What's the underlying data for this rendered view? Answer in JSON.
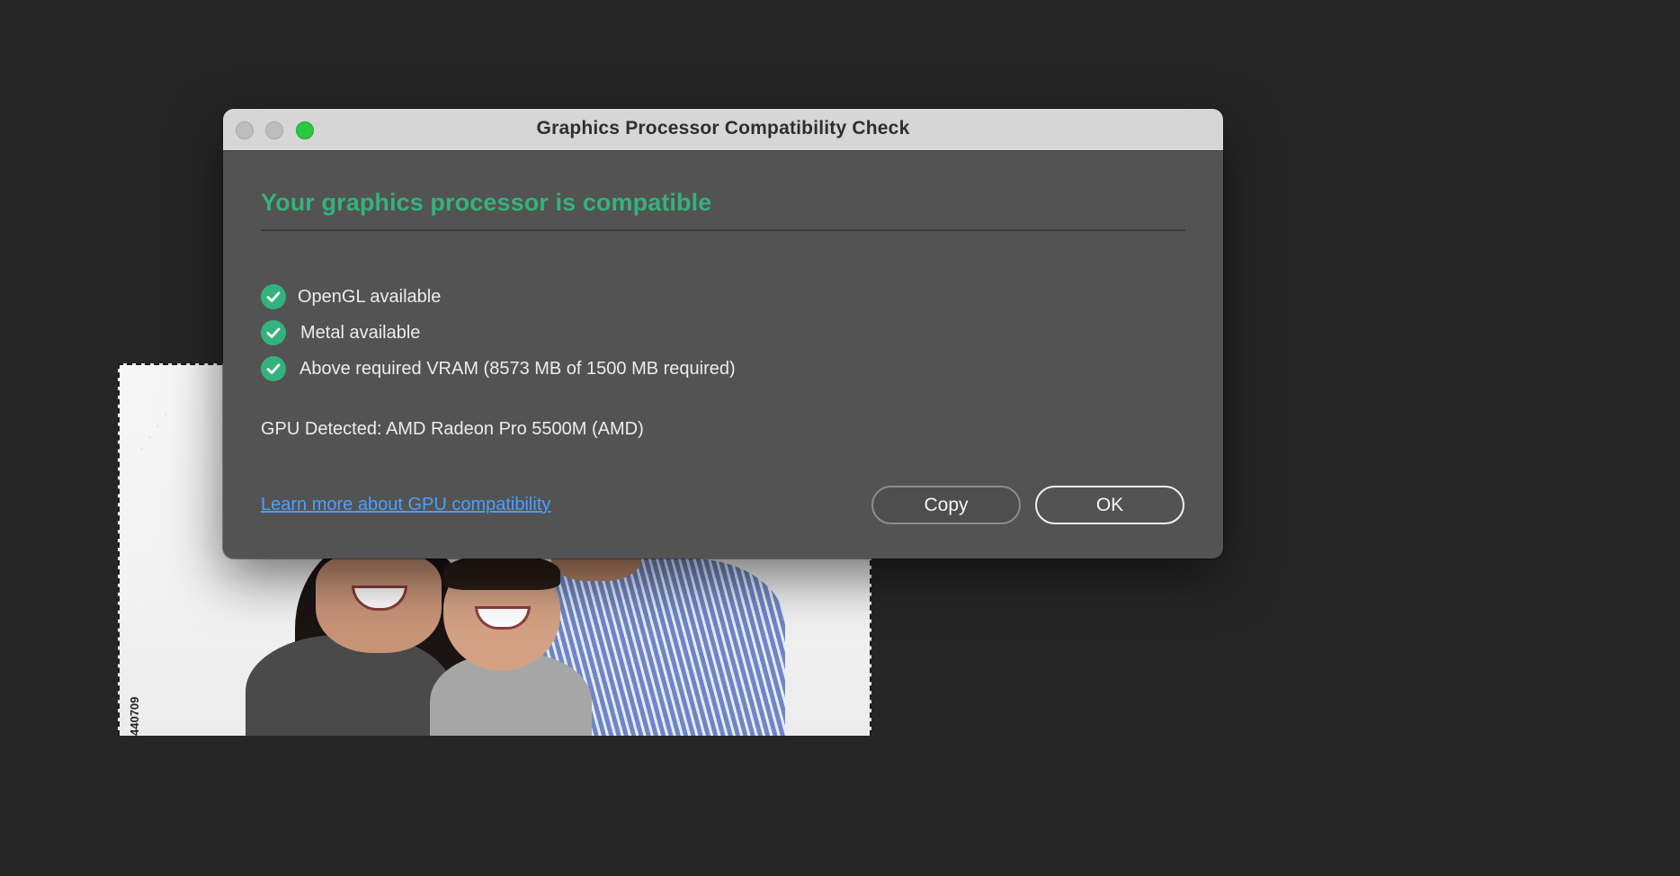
{
  "dialog": {
    "title": "Graphics Processor Compatibility Check",
    "headline": "Your graphics processor is compatible",
    "checks": [
      {
        "label": "OpenGL available"
      },
      {
        "label": "Metal available"
      },
      {
        "label": "Above required VRAM (8573 MB of 1500 MB required)"
      }
    ],
    "gpu_detected": "GPU Detected: AMD Radeon Pro 5500M (AMD)",
    "learn_more_link": "Learn more about GPU compatibility",
    "copy_button": "Copy",
    "ok_button": "OK"
  },
  "background_image": {
    "id_text": "440709"
  },
  "colors": {
    "accent_green": "#34b27d",
    "link_blue": "#4aa0ff",
    "dialog_bg": "#535353",
    "titlebar_bg": "#d6d6d6",
    "zoom_button": "#2ac840",
    "app_bg": "#262626"
  },
  "icons": {
    "check": "checkmark-circle-icon"
  }
}
